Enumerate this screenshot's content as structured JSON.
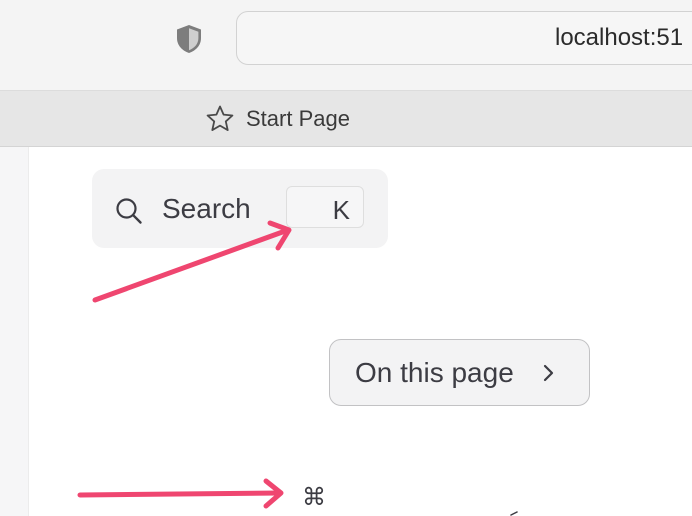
{
  "browser": {
    "address": "localhost:51",
    "bookmarks": [
      {
        "label": "Start Page",
        "icon": "star-icon"
      }
    ]
  },
  "page": {
    "search": {
      "label": "Search",
      "shortcut_key": "K",
      "icon": "search-icon"
    },
    "outline_button": {
      "label": "On this page",
      "icon": "chevron-right-icon"
    },
    "cmd_symbol": "⌘"
  },
  "annotations": {
    "arrow_color": "#ef4670"
  }
}
